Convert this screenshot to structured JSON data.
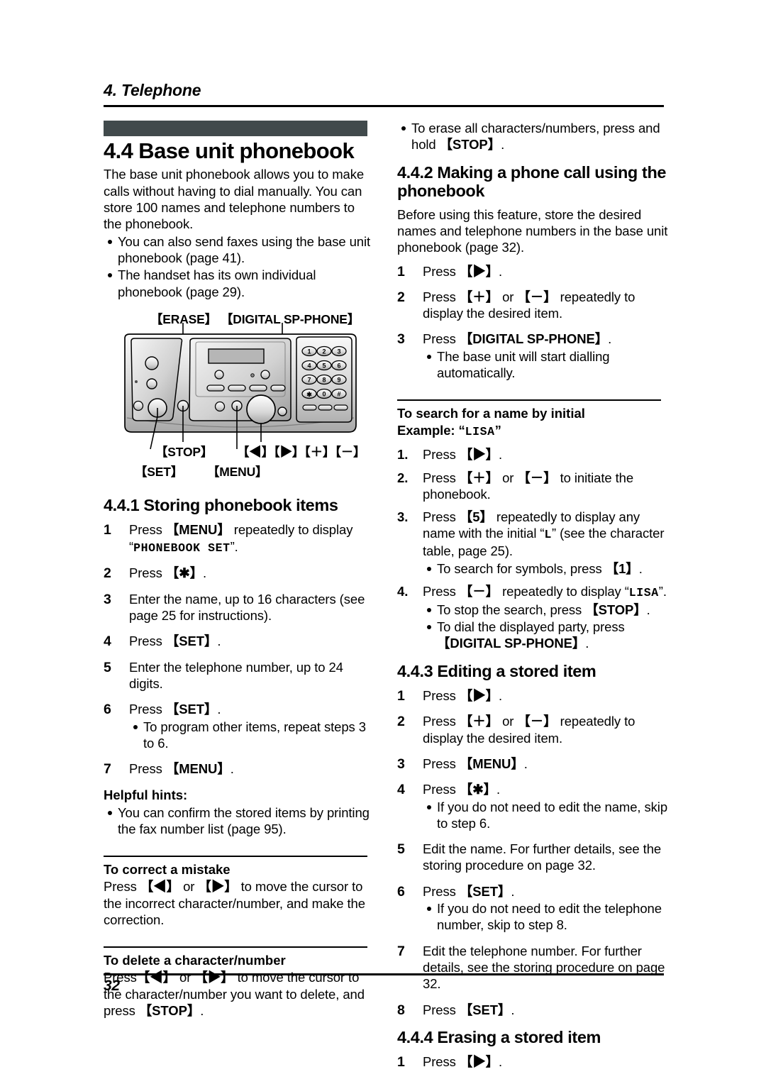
{
  "running_head": {
    "chapter": "4. Telephone"
  },
  "footer": {
    "page_number": "32"
  },
  "left_column": {
    "section": {
      "title": "4.4 Base unit phonebook",
      "intro": "The base unit phonebook allows you to make calls without having to dial manually. You can store 100 names and telephone numbers to the phonebook.",
      "bullets": [
        "You can also send faxes using the base unit phonebook (page 41).",
        "The handset has its own individual phonebook (page 29)."
      ]
    },
    "figure": {
      "labels": {
        "erase": "【ERASE】",
        "digital_sp_phone": "【DIGITAL SP-PHONE】",
        "stop": "【STOP】",
        "set": "【SET】",
        "menu": "【MENU】",
        "nav_keys": "【◀】【▶】【＋】【－】"
      },
      "keypad": [
        "1",
        "2",
        "3",
        "4",
        "5",
        "6",
        "7",
        "8",
        "9",
        "✱",
        "0",
        "#"
      ]
    },
    "subsection": {
      "title": "4.4.1 Storing phonebook items",
      "steps": [
        {
          "num": "1",
          "text_a": "Press ",
          "key": "【MENU】",
          "text_b": " repeatedly to display ",
          "quote_open": "“",
          "lcd": "PHONEBOOK SET",
          "quote_close": "”",
          "text_c": "."
        },
        {
          "num": "2",
          "text_a": "Press ",
          "key": "【✱】",
          "text_b": "."
        },
        {
          "num": "3",
          "text_a": "Enter the name, up to 16 characters (see page 25 for instructions)."
        },
        {
          "num": "4",
          "text_a": "Press ",
          "key": "【SET】",
          "text_b": "."
        },
        {
          "num": "5",
          "text_a": "Enter the telephone number, up to 24 digits."
        },
        {
          "num": "6",
          "text_a": "Press ",
          "key": "【SET】",
          "text_b": ".",
          "bullets": [
            "To program other items, repeat steps 3 to 6."
          ]
        },
        {
          "num": "7",
          "text_a": "Press ",
          "key": "【MENU】",
          "text_b": "."
        }
      ],
      "helpful_hints_title": "Helpful hints:",
      "helpful_hints": [
        "You can confirm the stored items by printing the fax number list (page 95)."
      ]
    },
    "correct_mistake": {
      "title": "To correct a mistake",
      "text_a": "Press ",
      "key_left": "【◀】",
      "text_or": " or ",
      "key_right": "【▶】",
      "text_b": " to move the cursor to the incorrect character/number, and make the correction."
    },
    "delete_character": {
      "title": "To delete a character/number",
      "text_a": "Press",
      "key_left": "【◀】",
      "text_or": " or ",
      "key_right": "【▶】",
      "text_b": " to move the cursor to the character/number you want to delete, and press ",
      "key_stop": "【STOP】",
      "text_c": "."
    }
  },
  "right_column": {
    "top_bullets": [
      {
        "text_a": "To erase all characters/numbers, press and hold ",
        "key": "【STOP】",
        "text_b": "."
      }
    ],
    "subsection_442": {
      "title": "4.4.2 Making a phone call using the phonebook",
      "intro": "Before using this feature, store the desired names and telephone numbers in the base unit phonebook (page 32).",
      "steps": [
        {
          "num": "1",
          "text_a": "Press ",
          "key": "【▶】",
          "text_b": "."
        },
        {
          "num": "2",
          "text_a": "Press ",
          "key": "【＋】",
          "text_or": " or ",
          "key2": "【－】",
          "text_b": " repeatedly to display the desired item."
        },
        {
          "num": "3",
          "text_a": "Press ",
          "key": "【DIGITAL SP-PHONE】",
          "text_b": ".",
          "bullets": [
            "The base unit will start dialling automatically."
          ]
        }
      ]
    },
    "search_by_initial": {
      "title": "To search for a name by initial",
      "example_label": "Example: ",
      "example_quote_open": "“",
      "example_value": "LISA",
      "example_quote_close": "”",
      "steps": [
        {
          "num": "1.",
          "text_a": "Press ",
          "key": "【▶】",
          "text_b": "."
        },
        {
          "num": "2.",
          "text_a": "Press ",
          "key": "【＋】",
          "text_or": " or ",
          "key2": "【－】",
          "text_b": " to initiate the phonebook."
        },
        {
          "num": "3.",
          "text_a": "Press ",
          "key": "【5】",
          "text_b": " repeatedly to display any name with the initial ",
          "quote_open": "“",
          "lcd": "L",
          "quote_close": "”",
          "text_c": " (see the character table, page 25).",
          "bullets_rich": [
            {
              "text_a": "To search for symbols, press ",
              "key": "【1】",
              "text_b": "."
            }
          ]
        },
        {
          "num": "4.",
          "text_a": "Press ",
          "key": "【－】",
          "text_b": " repeatedly to display ",
          "quote_open": "“",
          "lcd": "LISA",
          "quote_close": "”",
          "text_c": ".",
          "bullets_rich": [
            {
              "text_a": "To stop the search, press ",
              "key": "【STOP】",
              "text_b": "."
            },
            {
              "text_a": "To dial the displayed party, press ",
              "key": "【DIGITAL SP-PHONE】",
              "text_b": "."
            }
          ]
        }
      ]
    },
    "subsection_443": {
      "title": "4.4.3 Editing a stored item",
      "steps": [
        {
          "num": "1",
          "text_a": "Press ",
          "key": "【▶】",
          "text_b": "."
        },
        {
          "num": "2",
          "text_a": "Press ",
          "key": "【＋】",
          "text_or": " or ",
          "key2": "【－】",
          "text_b": " repeatedly to display the desired item."
        },
        {
          "num": "3",
          "text_a": "Press ",
          "key": "【MENU】",
          "text_b": "."
        },
        {
          "num": "4",
          "text_a": "Press ",
          "key": "【✱】",
          "text_b": ".",
          "bullets": [
            "If you do not need to edit the name, skip to step 6."
          ]
        },
        {
          "num": "5",
          "text_a": "Edit the name. For further details, see the storing procedure on page 32."
        },
        {
          "num": "6",
          "text_a": "Press ",
          "key": "【SET】",
          "text_b": ".",
          "bullets": [
            "If you do not need to edit the telephone number, skip to step 8."
          ]
        },
        {
          "num": "7",
          "text_a": "Edit the telephone number. For further details, see the storing procedure on page 32."
        },
        {
          "num": "8",
          "text_a": "Press ",
          "key": "【SET】",
          "text_b": "."
        }
      ]
    },
    "subsection_444": {
      "title": "4.4.4 Erasing a stored item",
      "steps": [
        {
          "num": "1",
          "text_a": "Press ",
          "key": "【▶】",
          "text_b": "."
        }
      ]
    }
  },
  "colors": {
    "section_bar": "#414a4c",
    "rule": "#000000",
    "device_body_light": "#f0f0f0",
    "device_body_mid": "#c9c9c9",
    "device_body_dark": "#9a9a9a",
    "lcd_screen": "#b6b6b6"
  }
}
